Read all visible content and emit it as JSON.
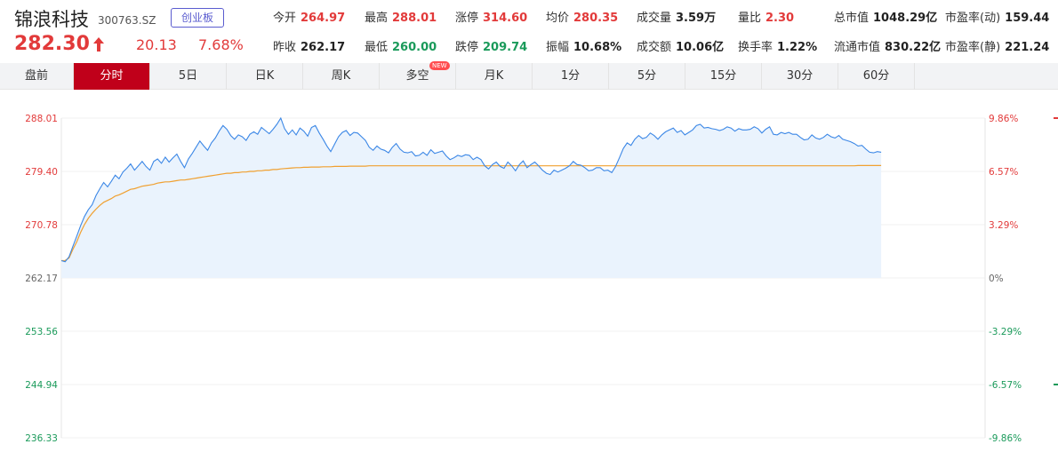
{
  "header": {
    "name": "锦浪科技",
    "code": "300763.SZ",
    "board": "创业板",
    "price": "282.30",
    "change": "20.13",
    "change_pct": "7.68%"
  },
  "stats": [
    {
      "label": "今开",
      "value": "264.97",
      "color": "red"
    },
    {
      "label": "最高",
      "value": "288.01",
      "color": "red"
    },
    {
      "label": "涨停",
      "value": "314.60",
      "color": "red"
    },
    {
      "label": "均价",
      "value": "280.35",
      "color": "red"
    },
    {
      "label": "成交量",
      "value": "3.59万",
      "color": "dark"
    },
    {
      "label": "量比",
      "value": "2.30",
      "color": "red"
    },
    {
      "label": "总市值",
      "value": "1048.29亿",
      "color": "dark"
    },
    {
      "label": "市盈率(动)",
      "value": "159.44",
      "color": "dark"
    },
    {
      "label": "昨收",
      "value": "262.17",
      "color": "dark"
    },
    {
      "label": "最低",
      "value": "260.00",
      "color": "green"
    },
    {
      "label": "跌停",
      "value": "209.74",
      "color": "green"
    },
    {
      "label": "振幅",
      "value": "10.68%",
      "color": "dark"
    },
    {
      "label": "成交额",
      "value": "10.06亿",
      "color": "dark"
    },
    {
      "label": "换手率",
      "value": "1.22%",
      "color": "dark"
    },
    {
      "label": "流通市值",
      "value": "830.22亿",
      "color": "dark"
    },
    {
      "label": "市盈率(静)",
      "value": "221.24",
      "color": "dark"
    }
  ],
  "tabs": [
    "盘前",
    "分时",
    "5日",
    "日K",
    "周K",
    "多空",
    "月K",
    "1分",
    "5分",
    "15分",
    "30分",
    "60分"
  ],
  "active_tab": "分时",
  "new_badge": "NEW",
  "colors": {
    "up": "#e23a3a",
    "down": "#1a9a5a",
    "price_line": "#3b87e6",
    "avg_line": "#f0a030",
    "fill": "#eaf3fd"
  },
  "chart_data": {
    "type": "line",
    "y_left_ticks": [
      "288.01",
      "279.40",
      "270.78",
      "262.17",
      "253.56",
      "244.94",
      "236.33"
    ],
    "y_right_ticks": [
      "9.86%",
      "6.57%",
      "3.29%",
      "0%",
      "-3.29%",
      "-6.57%",
      "-9.86%"
    ],
    "ylim": [
      236.33,
      288.01
    ],
    "prev_close": 262.17,
    "total_minutes": 240,
    "series": [
      {
        "values": [
          264.97,
          264.8,
          265.6,
          267.3,
          268.9,
          270.6,
          272.1,
          273.2,
          274.0,
          275.5,
          276.6,
          277.6,
          276.9,
          277.8,
          278.8,
          278.2,
          279.3,
          279.9,
          280.6,
          279.6,
          280.3,
          281.0,
          280.2,
          279.6,
          281.0,
          281.4,
          280.7,
          281.7,
          280.9,
          281.6,
          282.2,
          281.0,
          280.0,
          281.4,
          282.3,
          283.3,
          284.3,
          283.5,
          282.8,
          284.0,
          284.8,
          285.9,
          286.8,
          286.2,
          285.2,
          284.6,
          285.3,
          285.0,
          284.4,
          285.4,
          285.8,
          285.4,
          286.5,
          286.0,
          285.5,
          286.2,
          287.0,
          288.01,
          286.3,
          285.4,
          286.1,
          285.3,
          286.4,
          285.9,
          285.1,
          286.5,
          286.8,
          285.6,
          284.6,
          283.5,
          282.6,
          283.8,
          285.0,
          285.7,
          286.0,
          285.2,
          285.7,
          285.6,
          285.0,
          284.4,
          283.3,
          282.8,
          283.5,
          283.0,
          282.8,
          282.4,
          283.3,
          283.9,
          283.0,
          282.5,
          282.4,
          282.6,
          281.9,
          282.0,
          282.5,
          282.0,
          282.9,
          282.3,
          282.5,
          282.7,
          281.9,
          281.3,
          281.6,
          282.0,
          281.8,
          282.1,
          282.0,
          281.3,
          281.7,
          281.3,
          280.3,
          279.8,
          280.5,
          280.9,
          280.2,
          279.9,
          280.9,
          280.3,
          279.5,
          280.5,
          281.1,
          280.0,
          280.5,
          280.9,
          280.3,
          279.6,
          279.1,
          278.9,
          279.6,
          279.3,
          279.6,
          279.9,
          280.3,
          281.0,
          280.5,
          280.4,
          280.0,
          279.5,
          279.6,
          280.0,
          280.0,
          279.5,
          279.6,
          279.2,
          280.2,
          281.6,
          283.1,
          284.0,
          283.6,
          284.6,
          285.2,
          284.7,
          284.9,
          285.6,
          285.2,
          284.6,
          285.3,
          285.8,
          286.1,
          286.4,
          285.7,
          286.0,
          285.3,
          285.7,
          286.1,
          286.8,
          287.0,
          286.4,
          286.5,
          286.3,
          286.2,
          286.0,
          286.2,
          286.6,
          286.4,
          285.9,
          286.3,
          286.1,
          286.1,
          286.2,
          286.6,
          286.3,
          285.6,
          286.2,
          286.6,
          285.4,
          285.3,
          285.7,
          285.5,
          285.7,
          285.4,
          285.4,
          284.9,
          284.5,
          284.6,
          285.3,
          284.8,
          284.6,
          284.9,
          285.4,
          285.0,
          284.8,
          285.2,
          284.6,
          284.4,
          284.2,
          283.9,
          283.5,
          283.6,
          283.0,
          282.5,
          282.4,
          282.6,
          282.5
        ],
        "color": "#3b87e6"
      },
      {
        "values": [
          264.97,
          265.0,
          265.4,
          266.8,
          268.0,
          269.5,
          270.8,
          271.8,
          272.6,
          273.3,
          273.9,
          274.4,
          274.7,
          275.0,
          275.4,
          275.6,
          275.9,
          276.2,
          276.5,
          276.6,
          276.8,
          277.0,
          277.1,
          277.2,
          277.3,
          277.5,
          277.6,
          277.7,
          277.7,
          277.8,
          277.9,
          278.0,
          278.0,
          278.1,
          278.2,
          278.3,
          278.4,
          278.5,
          278.6,
          278.7,
          278.8,
          278.9,
          279.0,
          279.1,
          279.1,
          279.2,
          279.2,
          279.3,
          279.3,
          279.4,
          279.4,
          279.5,
          279.5,
          279.6,
          279.6,
          279.7,
          279.7,
          279.8,
          279.85,
          279.9,
          279.95,
          280.0,
          280.0,
          280.05,
          280.05,
          280.1,
          280.1,
          280.1,
          280.15,
          280.15,
          280.15,
          280.2,
          280.2,
          280.2,
          280.2,
          280.25,
          280.25,
          280.25,
          280.25,
          280.25,
          280.3,
          280.3,
          280.3,
          280.3,
          280.3,
          280.3,
          280.3,
          280.3,
          280.3,
          280.3,
          280.3,
          280.3,
          280.3,
          280.3,
          280.3,
          280.3,
          280.3,
          280.3,
          280.3,
          280.3,
          280.3,
          280.3,
          280.3,
          280.3,
          280.3,
          280.3,
          280.3,
          280.3,
          280.3,
          280.3,
          280.3,
          280.3,
          280.3,
          280.3,
          280.3,
          280.3,
          280.3,
          280.3,
          280.3,
          280.3,
          280.3,
          280.3,
          280.3,
          280.3,
          280.3,
          280.3,
          280.3,
          280.3,
          280.3,
          280.3,
          280.3,
          280.3,
          280.3,
          280.3,
          280.3,
          280.3,
          280.3,
          280.3,
          280.3,
          280.3,
          280.3,
          280.3,
          280.3,
          280.3,
          280.3,
          280.3,
          280.3,
          280.3,
          280.3,
          280.3,
          280.3,
          280.3,
          280.3,
          280.3,
          280.3,
          280.3,
          280.3,
          280.3,
          280.3,
          280.3,
          280.3,
          280.3,
          280.3,
          280.3,
          280.3,
          280.3,
          280.3,
          280.3,
          280.3,
          280.3,
          280.3,
          280.3,
          280.3,
          280.3,
          280.3,
          280.3,
          280.3,
          280.3,
          280.3,
          280.3,
          280.3,
          280.3,
          280.3,
          280.3,
          280.3,
          280.3,
          280.3,
          280.3,
          280.3,
          280.3,
          280.3,
          280.3,
          280.3,
          280.3,
          280.3,
          280.3,
          280.3,
          280.3,
          280.3,
          280.3,
          280.3,
          280.3,
          280.3,
          280.3,
          280.3,
          280.3,
          280.3,
          280.35,
          280.35,
          280.35,
          280.35,
          280.35,
          280.35,
          280.35
        ],
        "color": "#f0a030"
      }
    ]
  }
}
